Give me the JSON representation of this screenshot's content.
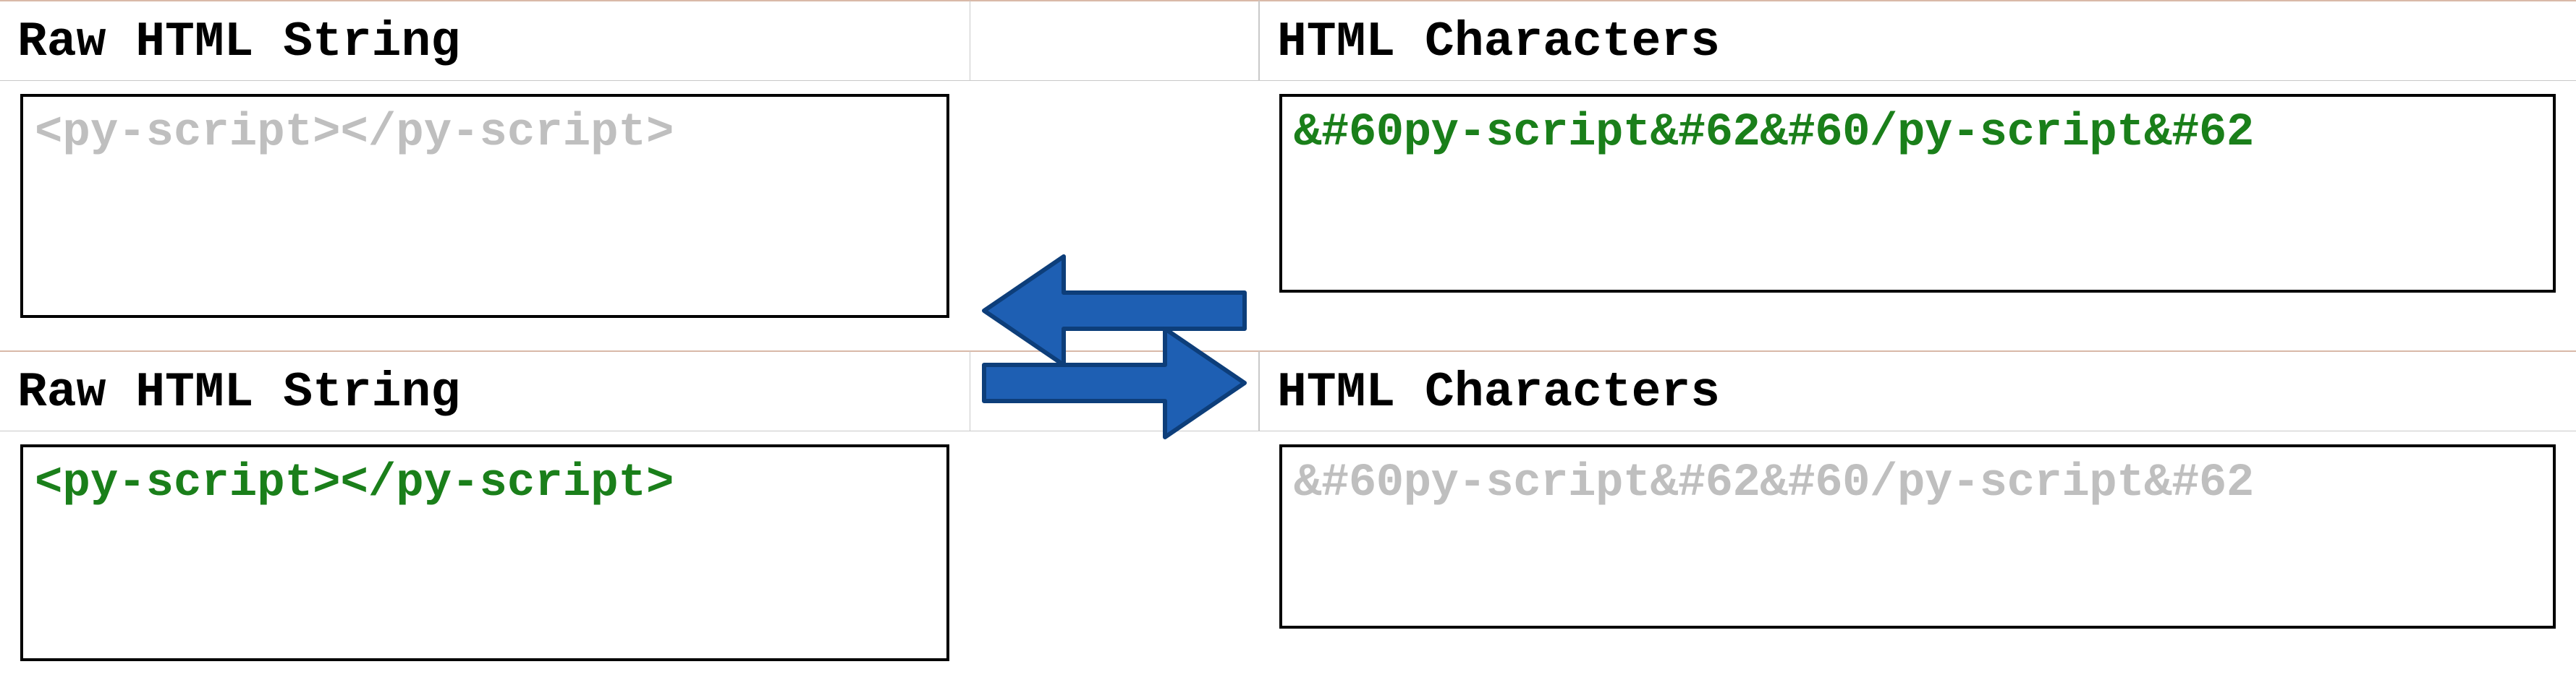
{
  "labels": {
    "raw_html": "Raw HTML String",
    "html_chars": "HTML Characters"
  },
  "top": {
    "raw_placeholder": "<py-script></py-script>",
    "chars_value": "&#60py-script&#62&#60/py-script&#62"
  },
  "bottom": {
    "raw_value": "<py-script></py-script>",
    "chars_placeholder": "&#60py-script&#62&#60/py-script&#62"
  },
  "icon": {
    "name": "swap-arrows",
    "color": "#1e5fb3"
  }
}
